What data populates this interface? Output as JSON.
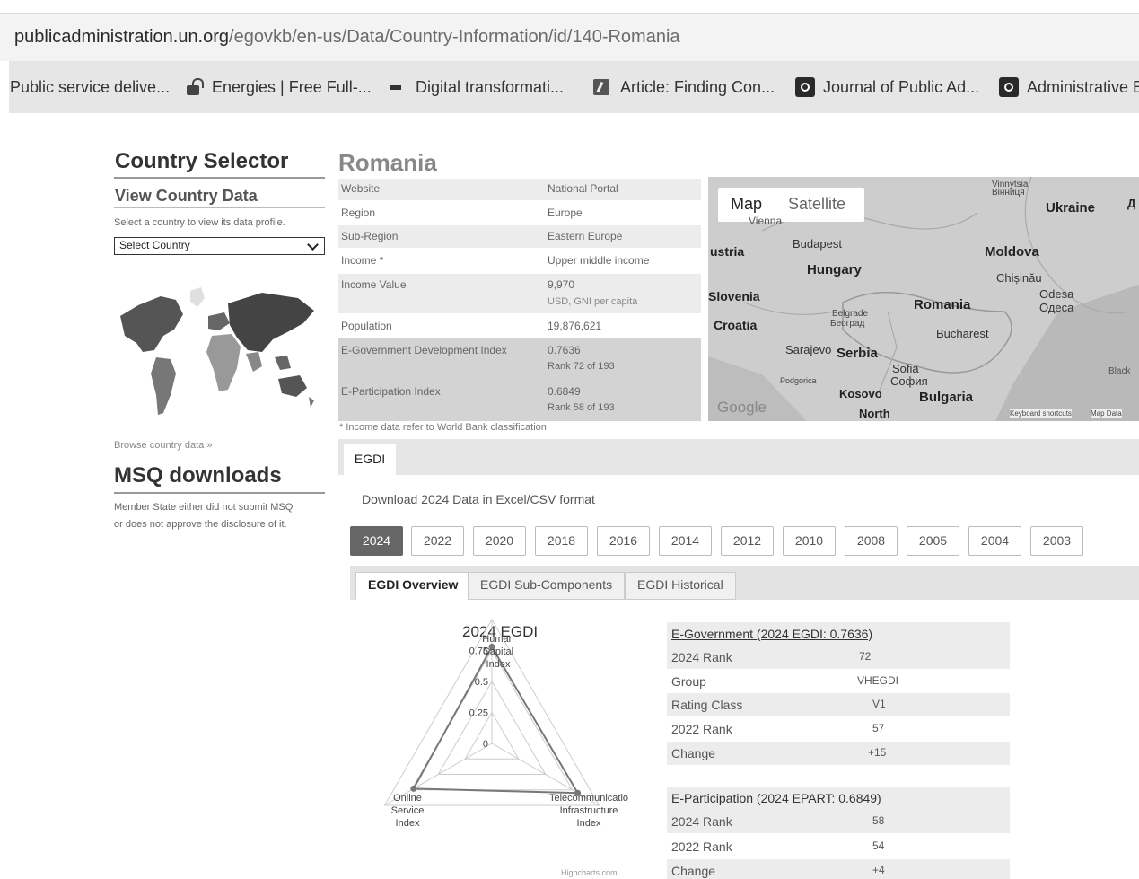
{
  "browser": {
    "url_domain": "publicadministration.un.org",
    "url_path": "/egovkb/en-us/Data/Country-Information/id/140-Romania",
    "bookmarks": [
      {
        "label": "Public service delive...",
        "icon": "none"
      },
      {
        "label": "Energies | Free Full-...",
        "icon": "lock-open-icon"
      },
      {
        "label": "Digital transformati...",
        "icon": "doc-icon"
      },
      {
        "label": "Article: Finding Con...",
        "icon": "article-icon"
      },
      {
        "label": "Journal of Public Ad...",
        "icon": "site-icon"
      },
      {
        "label": "Administrative E",
        "icon": "site-icon"
      }
    ]
  },
  "left": {
    "title": "Country Selector",
    "view_title": "View Country Data",
    "select_hint": "Select a country to view its data profile.",
    "select_value": "Select Country",
    "browse_link": "Browse country data »",
    "msq_title": "MSQ downloads",
    "msq_text_1": "Member State either did not submit MSQ",
    "msq_text_2": "or does not approve the disclosure of it."
  },
  "country": {
    "name": "Romania",
    "rows": [
      {
        "k": "Website",
        "v": "National Portal"
      },
      {
        "k": "Region",
        "v": "Europe"
      },
      {
        "k": "Sub-Region",
        "v": "Eastern Europe"
      },
      {
        "k": "Income *",
        "v": "Upper middle income"
      },
      {
        "k": "Income Value",
        "v": "9,970",
        "v2": "USD, GNI per capita"
      },
      {
        "k": "Population",
        "v": "19,876,621"
      },
      {
        "k": "E-Government Development Index",
        "v": "0.7636",
        "v2": "Rank 72 of 193"
      },
      {
        "k": "E-Participation Index",
        "v": "0.6849",
        "v2": "Rank 58 of 193"
      }
    ],
    "note": "* Income data refer to World Bank classification"
  },
  "map": {
    "tab_map": "Map",
    "tab_satellite": "Satellite",
    "labels": {
      "ukraine": "Ukraine",
      "moldova": "Moldova",
      "chisinau": "Chișinău",
      "odesa": "Odesa",
      "odesa_cyr": "Одеса",
      "vinnytsia": "Vinnytsia",
      "vinnytsia_cyr": "Вінниця",
      "budapest": "Budapest",
      "hungary": "Hungary",
      "austria": "ustria",
      "vienna": "Vienna",
      "slovenia": "Slovenia",
      "croatia": "Croatia",
      "romania": "Romania",
      "bucharest": "Bucharest",
      "belgrade": "Belgrade",
      "belgrade_cyr": "Београд",
      "sarajevo": "Sarajevo",
      "serbia": "Serbia",
      "sofia": "Sofia",
      "sofia_cyr": "София",
      "podgorica": "Podgorica",
      "kosovo": "Kosovo",
      "bulgaria": "Bulgaria",
      "north": "North",
      "black": "Black",
      "google": "Google",
      "shortcuts": "Keyboard shortcuts",
      "mapdata": "Map Data",
      "d": "Д"
    }
  },
  "egdi": {
    "tab": "EGDI",
    "download_text": "Download 2024 Data in Excel/CSV format",
    "years": [
      "2024",
      "2022",
      "2020",
      "2018",
      "2016",
      "2014",
      "2012",
      "2010",
      "2008",
      "2005",
      "2004",
      "2003"
    ],
    "active_year": "2024",
    "subtabs": [
      "EGDI Overview",
      "EGDI Sub-Components",
      "EGDI Historical"
    ],
    "egov": {
      "header": "E-Government (2024 EGDI: 0.7636)",
      "rows": [
        {
          "k": "2024 Rank",
          "v": "72"
        },
        {
          "k": "Group",
          "v": "VHEGDI"
        },
        {
          "k": "Rating Class",
          "v": "V1"
        },
        {
          "k": "2022 Rank",
          "v": "57"
        },
        {
          "k": "Change",
          "v": "+15"
        }
      ]
    },
    "epart": {
      "header": "E-Participation (2024 EPART: 0.6849)",
      "rows": [
        {
          "k": "2024 Rank",
          "v": "58"
        },
        {
          "k": "2022 Rank",
          "v": "54"
        },
        {
          "k": "Change",
          "v": "+4"
        }
      ]
    },
    "credit": "Highcharts.com"
  },
  "chart_data": {
    "type": "radar",
    "title": "2024 EGDI",
    "axes": [
      "Human Capital Index",
      "Online Service Index",
      "Telecommunication Infrastructure Index"
    ],
    "axis_label_lines": [
      [
        "Human",
        "Capital",
        "Index"
      ],
      [
        "Online",
        "Service",
        "Index"
      ],
      [
        "Telecommunicatio",
        "Infrastructure",
        "Index"
      ]
    ],
    "ticks": [
      "0",
      "0.25",
      "0.5",
      "0.75"
    ],
    "ylim": [
      0,
      1
    ],
    "series": [
      {
        "values": [
          0.78,
          0.73,
          0.8
        ]
      }
    ],
    "colors": {
      "series": "#777777",
      "grid": "#cccccc"
    }
  }
}
